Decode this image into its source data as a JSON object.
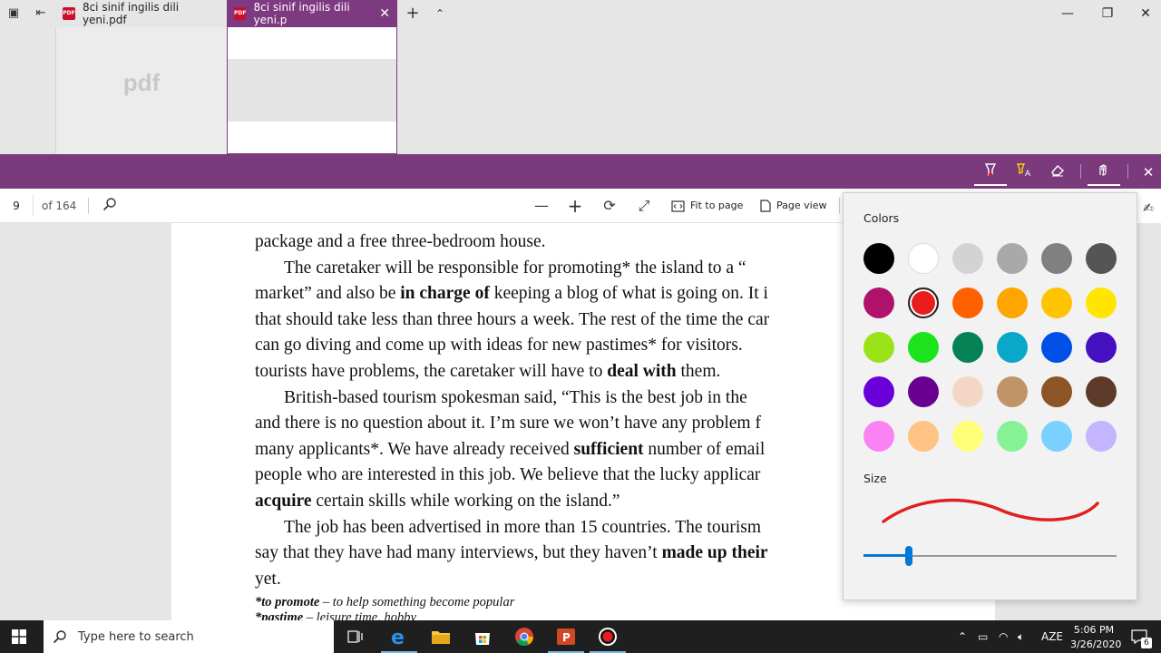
{
  "tabs": [
    {
      "title": "8ci sinif ingilis dili yeni.pdf",
      "thumb_label": "pdf"
    },
    {
      "title": "8ci sinif ingilis dili yeni.p",
      "close": "✕"
    }
  ],
  "window": {
    "minimize": "—",
    "restore": "❐",
    "close": "✕",
    "new_tab": "+",
    "tab_overview": "⌃"
  },
  "pdf_toolbar": {
    "page": "9",
    "page_of": "of 164",
    "fit_label": "Fit to page",
    "page_view_label": "Page view"
  },
  "document_lines": [
    {
      "parts": [
        {
          "t": "package and a free three-bedroom house."
        }
      ]
    },
    {
      "indent": true,
      "parts": [
        {
          "t": "The caretaker will be responsible for promoting* the island to a “"
        }
      ]
    },
    {
      "parts": [
        {
          "t": "market” and also be "
        },
        {
          "t": "in charge of",
          "b": true
        },
        {
          "t": " keeping a blog of what is going on. It i"
        }
      ]
    },
    {
      "parts": [
        {
          "t": "that should take less than three hours a week. The rest of the time the car"
        }
      ]
    },
    {
      "parts": [
        {
          "t": "can go diving and come up with ideas for new pastimes* for visitors."
        }
      ]
    },
    {
      "parts": [
        {
          "t": "tourists have problems, the caretaker will have to "
        },
        {
          "t": "deal with",
          "b": true
        },
        {
          "t": " them."
        }
      ]
    },
    {
      "indent": true,
      "parts": [
        {
          "t": "British-based tourism spokesman said, “This is the best job in the "
        }
      ]
    },
    {
      "parts": [
        {
          "t": "and there is no question about it. I’m sure we won’t have any problem f"
        }
      ]
    },
    {
      "parts": [
        {
          "t": "many applicants*. We have already received "
        },
        {
          "t": "sufficient",
          "b": true
        },
        {
          "t": " number of email"
        }
      ]
    },
    {
      "parts": [
        {
          "t": "people who are interested in this job. We believe that the lucky applicar"
        }
      ]
    },
    {
      "parts": [
        {
          "t": "acquire",
          "b": true
        },
        {
          "t": " certain skills while working on the island.”"
        }
      ]
    },
    {
      "indent": true,
      "parts": [
        {
          "t": "The job has been advertised in more than 15 countries. The tourism"
        }
      ]
    },
    {
      "parts": [
        {
          "t": "say that they have had many interviews, but they haven’t "
        },
        {
          "t": "made up their",
          "b": true
        }
      ]
    },
    {
      "parts": [
        {
          "t": "yet."
        }
      ]
    }
  ],
  "footnotes": [
    {
      "term": "*to promote",
      "def": " – to help something become popular"
    },
    {
      "term": "*pastime",
      "def": " – leisure time, hobby"
    }
  ],
  "flyout": {
    "colors_label": "Colors",
    "size_label": "Size",
    "size_value": 0.18,
    "selected_index": 7,
    "stroke_color": "#e02020",
    "swatches": [
      "#000000",
      "#ffffff",
      "#d3d3d3",
      "#a9a9a9",
      "#808080",
      "#555555",
      "#b0126b",
      "#e81c1c",
      "#ff6000",
      "#ffa500",
      "#ffc400",
      "#ffe500",
      "#9be319",
      "#1de31d",
      "#058156",
      "#09a8c9",
      "#0050e6",
      "#4510c0",
      "#6a00d8",
      "#6a0090",
      "#f4d6c4",
      "#c09467",
      "#8d5426",
      "#5e3a2a",
      "#fb82f4",
      "#ffc384",
      "#ffff78",
      "#85f395",
      "#7ad0ff",
      "#c3b5ff"
    ]
  },
  "taskbar": {
    "search_placeholder": "Type here to search",
    "lang": "AZE",
    "time": "5:06 PM",
    "date": "3/26/2020",
    "notifications": "6"
  },
  "colors": {
    "accent": "#7b3a7c",
    "taskbar": "#1f1f1f"
  }
}
